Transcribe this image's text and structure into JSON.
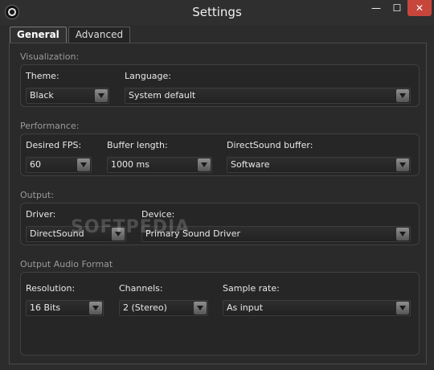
{
  "window": {
    "title": "Settings"
  },
  "title_buttons": {
    "minimize": "—",
    "maximize": "☐",
    "close": "✕"
  },
  "tabs": [
    {
      "label": "General"
    },
    {
      "label": "Advanced"
    }
  ],
  "sections": {
    "visualization": {
      "label": "Visualization:",
      "theme": {
        "label": "Theme:",
        "value": "Black"
      },
      "language": {
        "label": "Language:",
        "value": "System default"
      }
    },
    "performance": {
      "label": "Performance:",
      "fps": {
        "label": "Desired FPS:",
        "value": "60"
      },
      "buffer": {
        "label": "Buffer length:",
        "value": "1000 ms"
      },
      "directsound": {
        "label": "DirectSound buffer:",
        "value": "Software"
      }
    },
    "output": {
      "label": "Output:",
      "driver": {
        "label": "Driver:",
        "value": "DirectSound"
      },
      "device": {
        "label": "Device:",
        "value": "Primary Sound Driver"
      }
    },
    "audio_format": {
      "label": "Output Audio Format",
      "resolution": {
        "label": "Resolution:",
        "value": "16 Bits"
      },
      "channels": {
        "label": "Channels:",
        "value": "2 (Stereo)"
      },
      "sample_rate": {
        "label": "Sample rate:",
        "value": "As input"
      }
    }
  },
  "watermark": "SOFTPEDIA"
}
